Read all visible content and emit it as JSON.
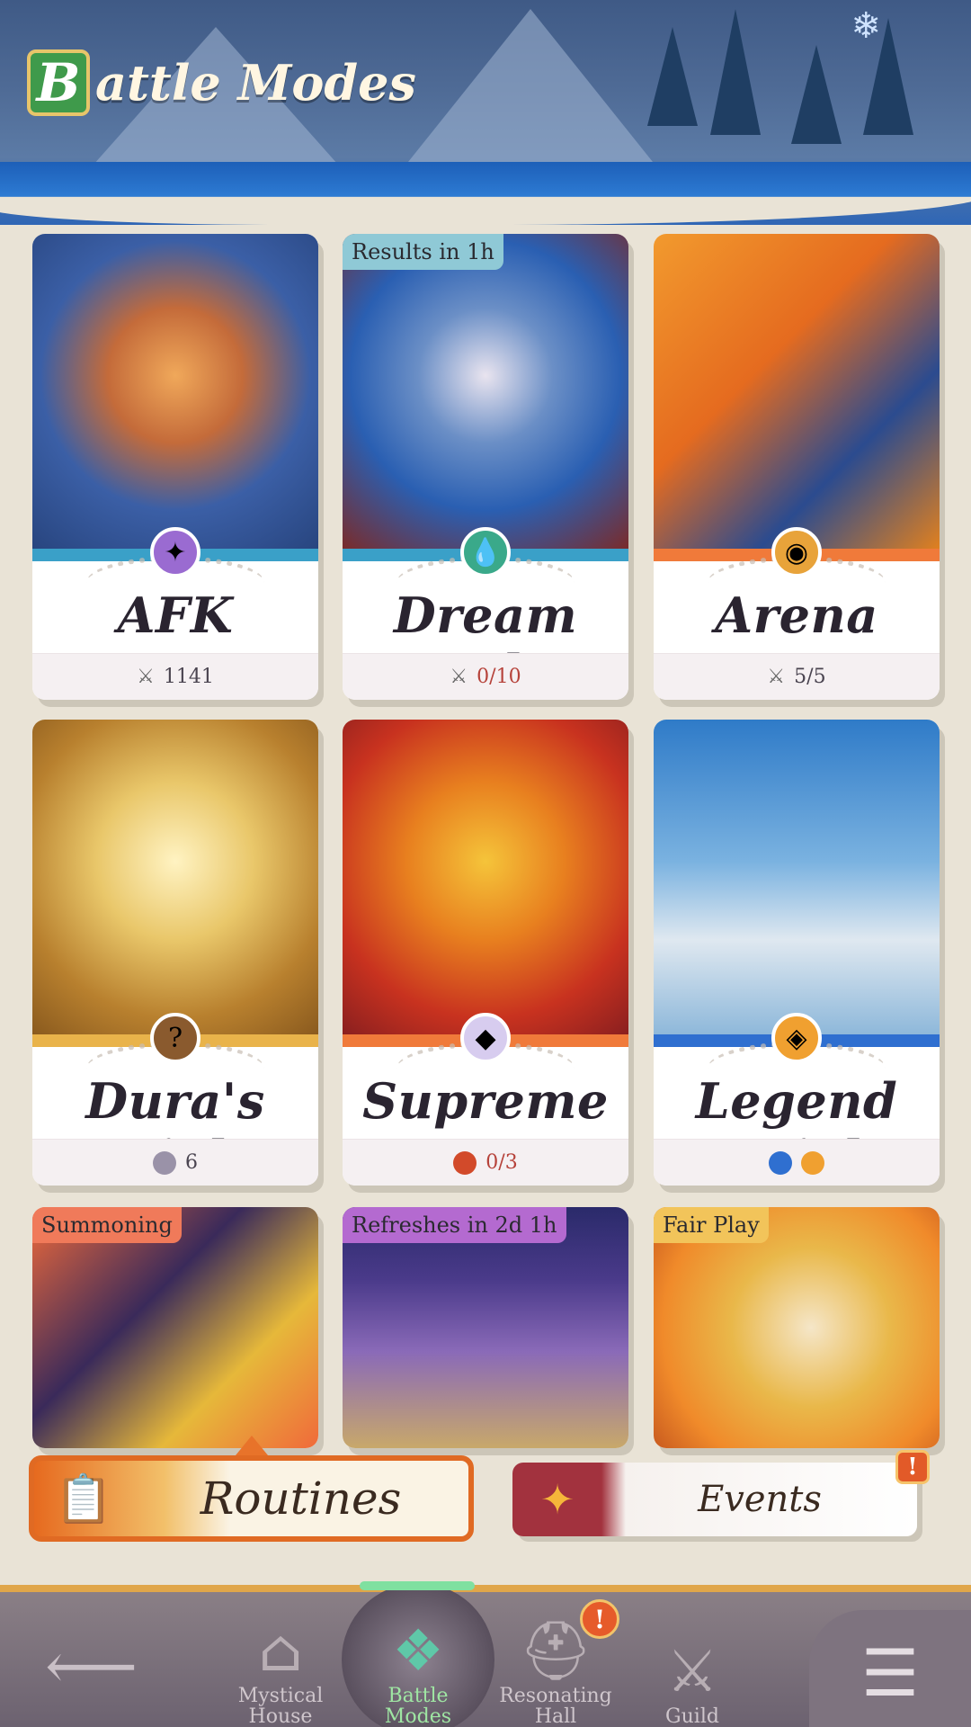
{
  "header": {
    "title_initial": "B",
    "title_rest": "attle Modes",
    "icon": "snowflake-icon"
  },
  "cards": [
    {
      "name": "AFK Stage",
      "footer_icon": "crossed-swords-icon",
      "footer_value": "1141",
      "tag": ""
    },
    {
      "name": "Dream Realm",
      "footer_icon": "crossed-swords-icon",
      "footer_value": "0/10",
      "tag": "Results in 1h"
    },
    {
      "name": "Arena",
      "footer_icon": "crossed-swords-icon",
      "footer_value": "5/5",
      "tag": ""
    },
    {
      "name": "Dura's Trials",
      "footer_icon": "coin-icon",
      "footer_value": "6",
      "tag": ""
    },
    {
      "name": "Supreme Arena",
      "footer_icon": "shield-token-icon",
      "footer_value": "0/3",
      "tag": ""
    },
    {
      "name": "Legend Trial",
      "footer_icon": "faction-icons",
      "footer_value": "",
      "tag": ""
    },
    {
      "name": "",
      "footer_icon": "",
      "footer_value": "",
      "tag": "Summoning"
    },
    {
      "name": "",
      "footer_icon": "",
      "footer_value": "",
      "tag": "Refreshes in 2d 1h"
    },
    {
      "name": "",
      "footer_icon": "",
      "footer_value": "",
      "tag": "Fair Play"
    }
  ],
  "buttons": {
    "routines": "Routines",
    "events": "Events",
    "events_badge": "!"
  },
  "nav": {
    "back_icon": "back-arrow-icon",
    "items": [
      {
        "label": "Mystical House",
        "icon": "house-icon"
      },
      {
        "label": "Battle Modes",
        "icon": "battle-modes-icon",
        "active": true
      },
      {
        "label": "Resonating Hall",
        "icon": "helmet-icon",
        "badge": "!"
      },
      {
        "label": "Guild",
        "icon": "guild-icon"
      }
    ],
    "menu_icon": "menu-icon"
  },
  "colors": {
    "accent_orange": "#e66a1f",
    "active_nav": "#9fe6a3",
    "warning_red": "#b6423a"
  }
}
